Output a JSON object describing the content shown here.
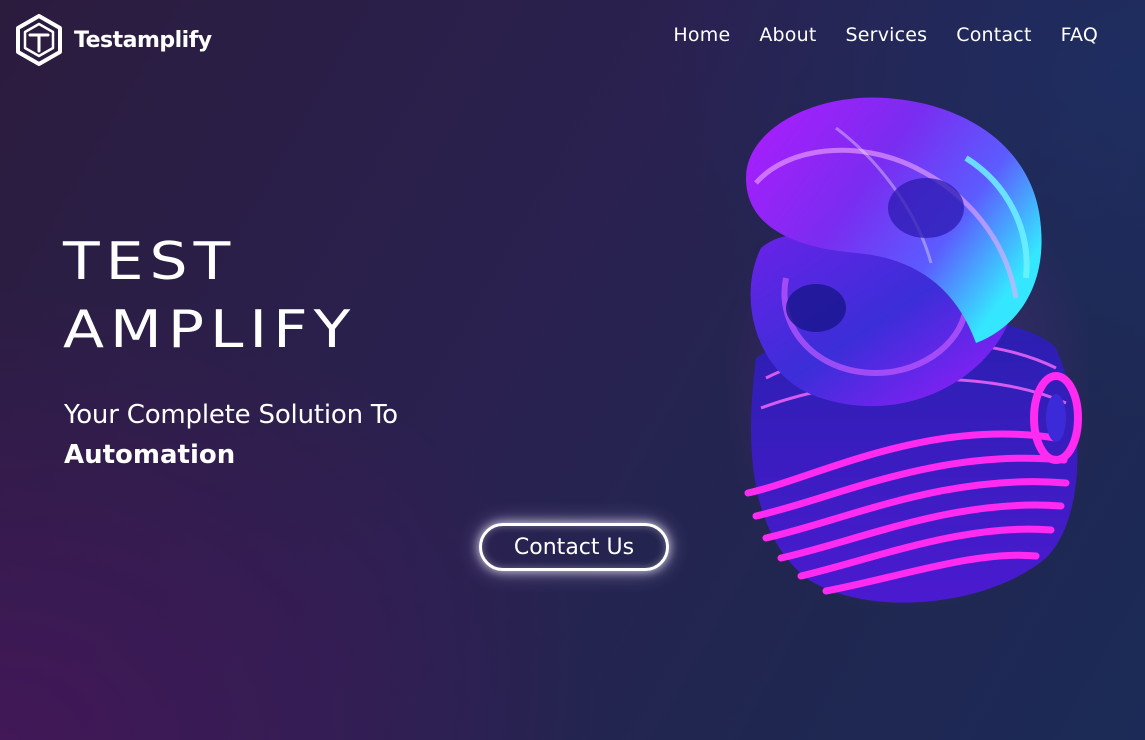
{
  "brand": {
    "name": "Testamplify",
    "logo_icon": "hexagon-t-logo-icon"
  },
  "nav": {
    "items": [
      {
        "label": "Home"
      },
      {
        "label": "About"
      },
      {
        "label": "Services"
      },
      {
        "label": "Contact"
      },
      {
        "label": "FAQ"
      }
    ]
  },
  "hero": {
    "title_line1": "TEST",
    "title_line2": "AMPLIFY",
    "subtitle_line1": "Your Complete Solution To",
    "subtitle_line2": "Automation",
    "cta_label": "Contact Us",
    "art": "abstract-3d-glass-sculpture"
  },
  "colors": {
    "background_dark": "#2a2150",
    "accent_magenta": "#e81cff",
    "accent_violet": "#7b2cff",
    "accent_cyan": "#3fe6ff",
    "text": "#ffffff"
  }
}
